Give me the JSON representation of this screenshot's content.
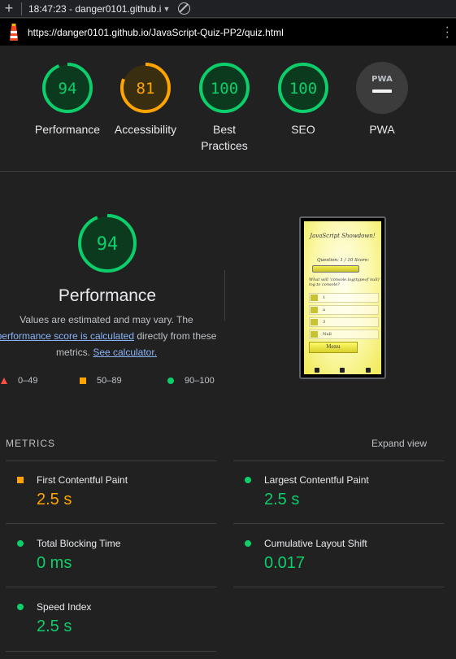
{
  "tab": {
    "title": "18:47:23 - danger0101.github.i"
  },
  "browser": {
    "url": "https://danger0101.github.io/JavaScript-Quiz-PP2/quiz.html"
  },
  "gauges": [
    {
      "label": "Performance",
      "value": "94",
      "score": 94,
      "color": "#0cce6b",
      "fill": "#0b3a1e"
    },
    {
      "label": "Accessibility",
      "value": "81",
      "score": 81,
      "color": "#ffa400",
      "fill": "#3a2e10"
    },
    {
      "label": "Best Practices",
      "value": "100",
      "score": 100,
      "color": "#0cce6b",
      "fill": "#0b3a1e"
    },
    {
      "label": "SEO",
      "value": "100",
      "score": 100,
      "color": "#0cce6b",
      "fill": "#0b3a1e"
    },
    {
      "label": "PWA",
      "badge": "PWA"
    }
  ],
  "performance": {
    "score": "94",
    "title": "Performance",
    "desc_before": "Values are estimated and may vary. The ",
    "desc_link1": "performance score is calculated",
    "desc_middle": " directly from these metrics. ",
    "desc_link2": "See calculator."
  },
  "legend": {
    "poor": "0–49",
    "average": "50–89",
    "good": "90–100"
  },
  "screenshot": {
    "title": "JavaScript Showdown!",
    "question": "Question: 1 / 10   Score:",
    "text": "What will 'console.log(typeof null)' log to console?",
    "options": [
      "1",
      "a",
      "3",
      "Null"
    ],
    "menu": "Menu"
  },
  "metrics": {
    "heading": "METRICS",
    "expand": "Expand view",
    "items": [
      {
        "name": "First Contentful Paint",
        "value": "2.5 s",
        "status": "average"
      },
      {
        "name": "Largest Contentful Paint",
        "value": "2.5 s",
        "status": "good"
      },
      {
        "name": "Total Blocking Time",
        "value": "0 ms",
        "status": "good"
      },
      {
        "name": "Cumulative Layout Shift",
        "value": "0.017",
        "status": "good"
      },
      {
        "name": "Speed Index",
        "value": "2.5 s",
        "status": "good"
      }
    ]
  }
}
